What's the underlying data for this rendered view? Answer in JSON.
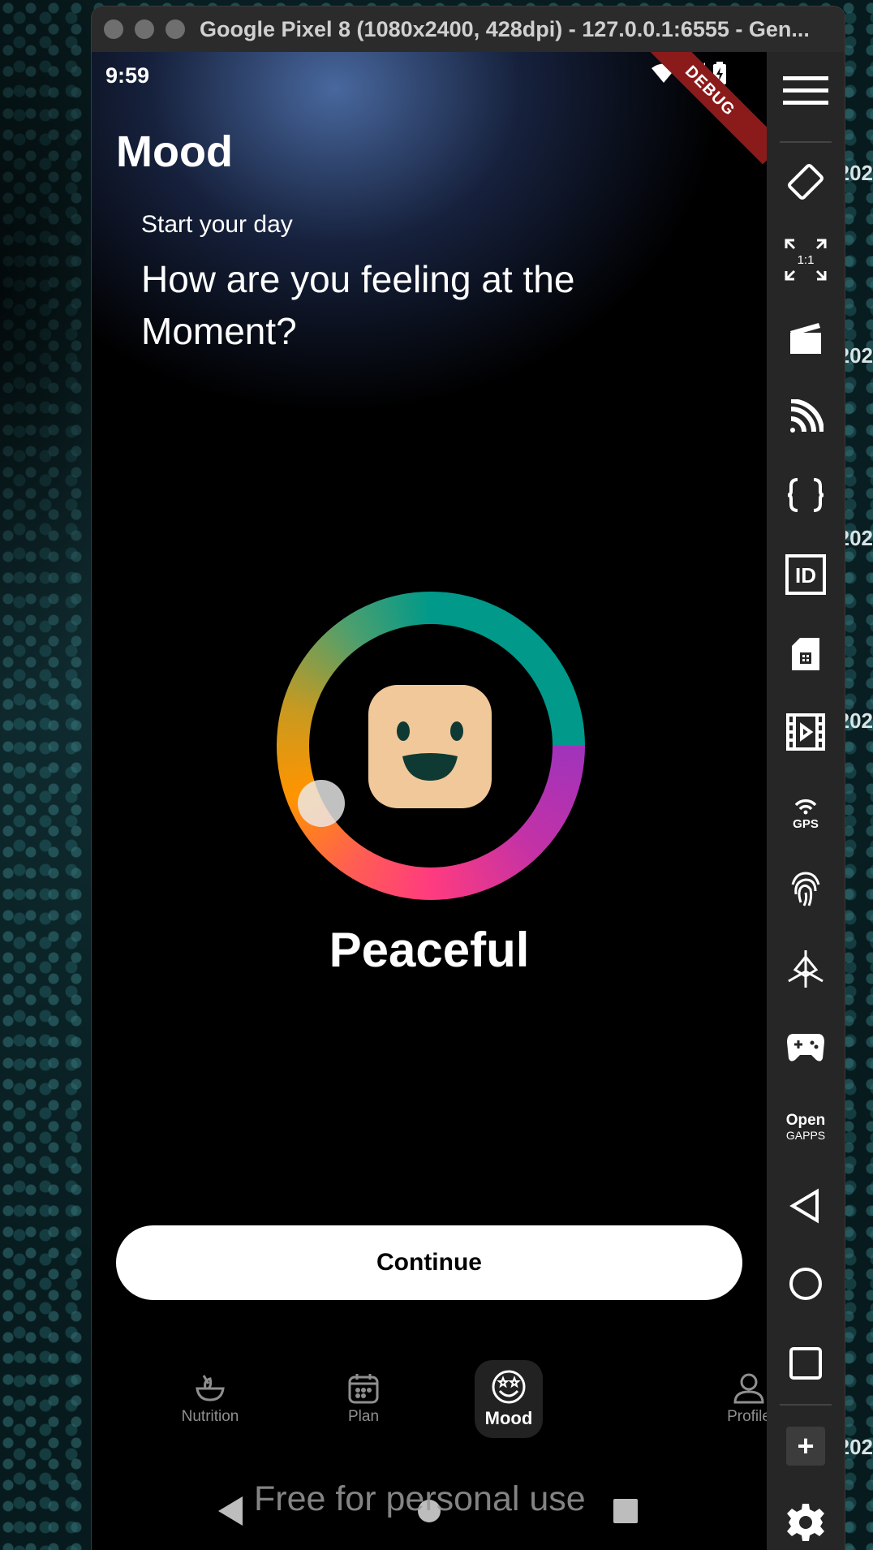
{
  "background": {
    "years": [
      "202",
      "202",
      "202",
      "202",
      "202"
    ]
  },
  "window": {
    "title": "Google Pixel 8 (1080x2400, 428dpi) - 127.0.0.1:6555 - Gen..."
  },
  "status_bar": {
    "time": "9:59",
    "debug_label": "DEBUG"
  },
  "app": {
    "page_title": "Mood",
    "subtitle": "Start your day",
    "question": "How are you feeling at the Moment?",
    "mood_label": "Peaceful",
    "continue_label": "Continue"
  },
  "bottom_nav": {
    "items": [
      {
        "label": "Nutrition",
        "icon": "bowl-icon",
        "active": false
      },
      {
        "label": "Plan",
        "icon": "calendar-icon",
        "active": false
      },
      {
        "label": "Mood",
        "icon": "mood-face-icon",
        "active": true
      },
      {
        "label": "Profile",
        "icon": "person-icon",
        "active": false
      }
    ]
  },
  "watermark": "Free for personal use",
  "toolbar": {
    "aspect_label": "1:1",
    "opengapps_top": "Open",
    "opengapps_bottom": "GAPPS",
    "tools": [
      "menu-icon",
      "rotate-icon",
      "fit-1-1-icon",
      "clapperboard-icon",
      "cast-icon",
      "braces-icon",
      "id-icon",
      "sim-card-icon",
      "screen-record-icon",
      "gps-icon",
      "fingerprint-icon",
      "sensors-icon",
      "gamepad-icon",
      "opengapps-icon",
      "back-icon",
      "home-icon",
      "overview-icon",
      "plus-icon",
      "settings-icon"
    ]
  },
  "colors": {
    "ring_teal": "#00998a",
    "ring_purple": "#a033bb",
    "ring_pink": "#ff3b7f",
    "ring_orange": "#ff9400",
    "face": "#f1c89a",
    "face_features": "#0f3a34",
    "debug_ribbon": "#8b1a1a"
  }
}
